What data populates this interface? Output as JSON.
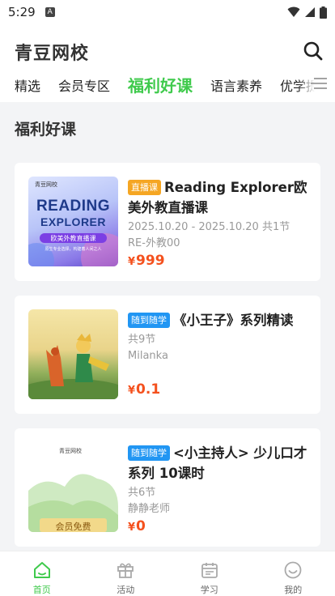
{
  "status_bar": {
    "time": "5:29"
  },
  "header": {
    "title": "青豆网校",
    "tabs": [
      {
        "label": "精选"
      },
      {
        "label": "会员专区"
      },
      {
        "label": "福利好课"
      },
      {
        "label": "语言素养"
      },
      {
        "label": "优学提"
      }
    ],
    "active_tab": "福利好课"
  },
  "section": {
    "title": "福利好课"
  },
  "courses": [
    {
      "badge": "直播课",
      "title": "Reading Explorer欧美外教直播课",
      "dates": "2025.10.20 - 2025.10.20",
      "lessons": "共1节",
      "teacher": "RE-外教00",
      "currency": "¥",
      "price": "999",
      "thumb": {
        "brand": "青豆网校",
        "line1": "READING",
        "line2": "EXPLORER",
        "ribbon": "欧美外教直播课",
        "caption": "原生专业选择，构建着人间之人"
      }
    },
    {
      "badge": "随到随学",
      "title": "《小王子》系列精读",
      "lessons": "共9节",
      "teacher": "Milanka",
      "currency": "¥",
      "price": "0.1"
    },
    {
      "badge": "随到随学",
      "title": "<小主持人> 少儿口才系列 10课时",
      "lessons": "共6节",
      "teacher": "静静老师",
      "currency": "¥",
      "price": "0",
      "thumb": {
        "brand": "青豆网校",
        "tag": "会员免费"
      }
    }
  ],
  "bottom_nav": [
    {
      "label": "首页",
      "icon": "home-icon"
    },
    {
      "label": "活动",
      "icon": "gift-icon"
    },
    {
      "label": "学习",
      "icon": "calendar-icon"
    },
    {
      "label": "我的",
      "icon": "smile-icon"
    }
  ],
  "colors": {
    "accent": "#3fca4c",
    "price": "#f4511e",
    "badge_live": "#f5a623",
    "badge_flex": "#2196f3"
  }
}
